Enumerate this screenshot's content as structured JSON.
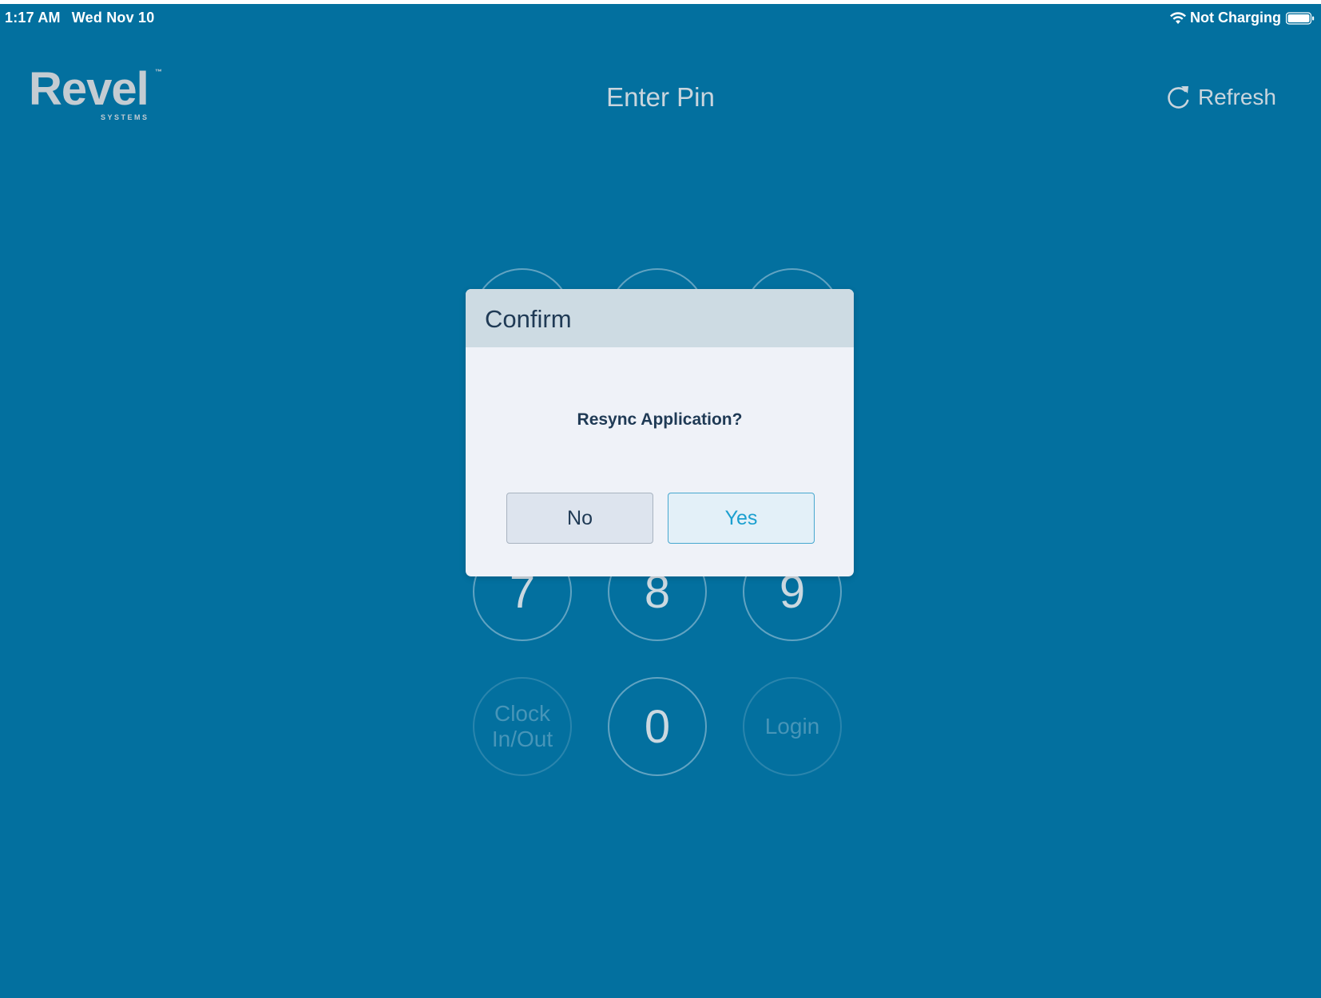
{
  "status_bar": {
    "time": "1:17 AM",
    "date": "Wed Nov 10",
    "charging_status": "Not Charging",
    "icons": [
      "wifi-icon",
      "battery-icon"
    ]
  },
  "header": {
    "logo_text": "Revel",
    "logo_tm": "™",
    "logo_subtext": "SYSTEMS",
    "title": "Enter Pin",
    "refresh_label": "Refresh",
    "refresh_icon": "refresh-icon"
  },
  "keypad": {
    "key_7": "7",
    "key_8": "8",
    "key_9": "9",
    "key_0": "0",
    "clock_line1": "Clock",
    "clock_line2": "In/Out",
    "login": "Login"
  },
  "dialog": {
    "title": "Confirm",
    "message": "Resync Application?",
    "no_label": "No",
    "yes_label": "Yes"
  },
  "colors": {
    "background": "#03709f",
    "dialog_header": "#cddbe3",
    "dialog_body": "#eff2f8",
    "yes_accent": "#1b9fcf"
  }
}
